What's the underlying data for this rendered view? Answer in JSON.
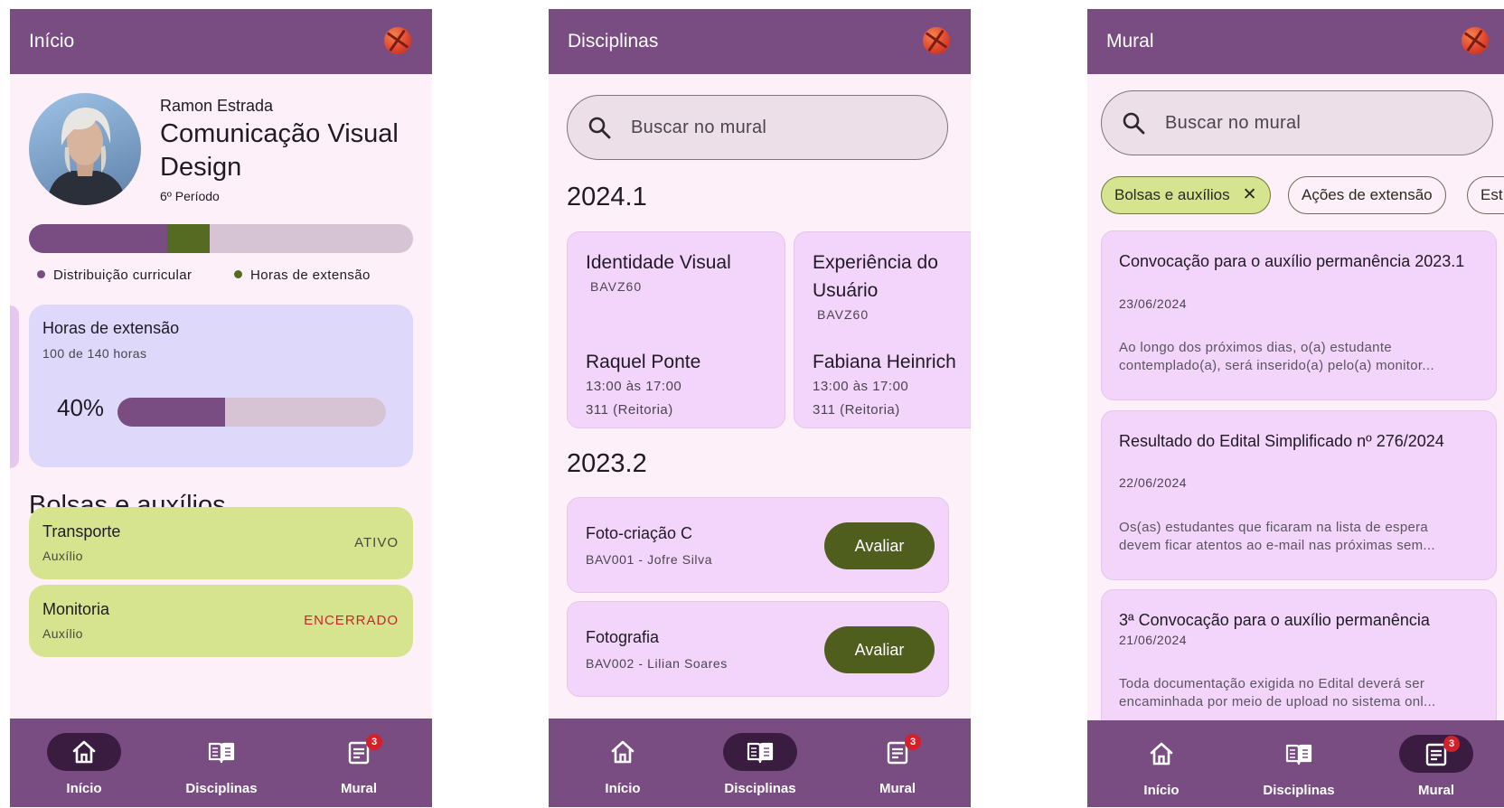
{
  "nav": {
    "inicio": "Início",
    "disciplinas": "Disciplinas",
    "mural": "Mural",
    "mural_badge": "3"
  },
  "screen1": {
    "title": "Início",
    "student_name": "Ramon Estrada",
    "course": "Comunicação Visual Design",
    "period": "6º Período",
    "curriculum_progress": {
      "distribution_fraction": 0.36,
      "extension_fraction": 0.11
    },
    "legend": {
      "distribution": "Distribuição curricular",
      "extension": "Horas de extensão"
    },
    "extension_card": {
      "title": "Horas de extensão",
      "subtitle": "100 de 140 horas",
      "percent_label": "40%",
      "percent": 40
    },
    "section_title": "Bolsas e auxílios",
    "aids": [
      {
        "title": "Transporte",
        "subtitle": "Auxílio",
        "status": "ATIVO"
      },
      {
        "title": "Monitoria",
        "subtitle": "Auxílio",
        "status": "ENCERRADO"
      }
    ],
    "colors": {
      "primary": "#794d82",
      "extension": "#566b22",
      "status_closed": "#c62828"
    }
  },
  "screen2": {
    "title": "Disciplinas",
    "search_placeholder": "Buscar no mural",
    "year1": "2024.1",
    "courses": [
      {
        "title": "Identidade Visual",
        "code": "BAVZ60",
        "professor": "Raquel Ponte",
        "time": "13:00 às 17:00",
        "room": "311 (Reitoria)"
      },
      {
        "title": "Experiência do Usuário",
        "code": "BAVZ60",
        "professor": "Fabiana Heinrich",
        "time": "13:00 às 17:00",
        "room": "311 (Reitoria)"
      }
    ],
    "year2": "2023.2",
    "evaluations": [
      {
        "title": "Foto-criação C",
        "subtitle": "BAV001 - Jofre Silva",
        "button": "Avaliar"
      },
      {
        "title": "Fotografia",
        "subtitle": "BAV002 - Lilian Soares",
        "button": "Avaliar"
      }
    ]
  },
  "screen3": {
    "title": "Mural",
    "search_placeholder": "Buscar no mural",
    "chips": [
      "Bolsas e auxílios",
      "Ações de extensão",
      "Est"
    ],
    "posts": [
      {
        "title": "Convocação para o auxílio permanência 2023.1",
        "date": "23/06/2024",
        "body": "Ao longo dos próximos dias, o(a) estudante contemplado(a), será inserido(a) pelo(a) monitor..."
      },
      {
        "title": "Resultado do Edital Simplificado nº 276/2024",
        "date": "22/06/2024",
        "body": "Os(as) estudantes que ficaram na lista de espera devem ficar atentos ao e-mail nas próximas sem..."
      },
      {
        "title": "3ª Convocação para o auxílio permanência",
        "date": "21/06/2024",
        "body": "Toda documentação exigida no Edital deverá ser encaminhada por meio de upload no sistema onl..."
      }
    ]
  }
}
